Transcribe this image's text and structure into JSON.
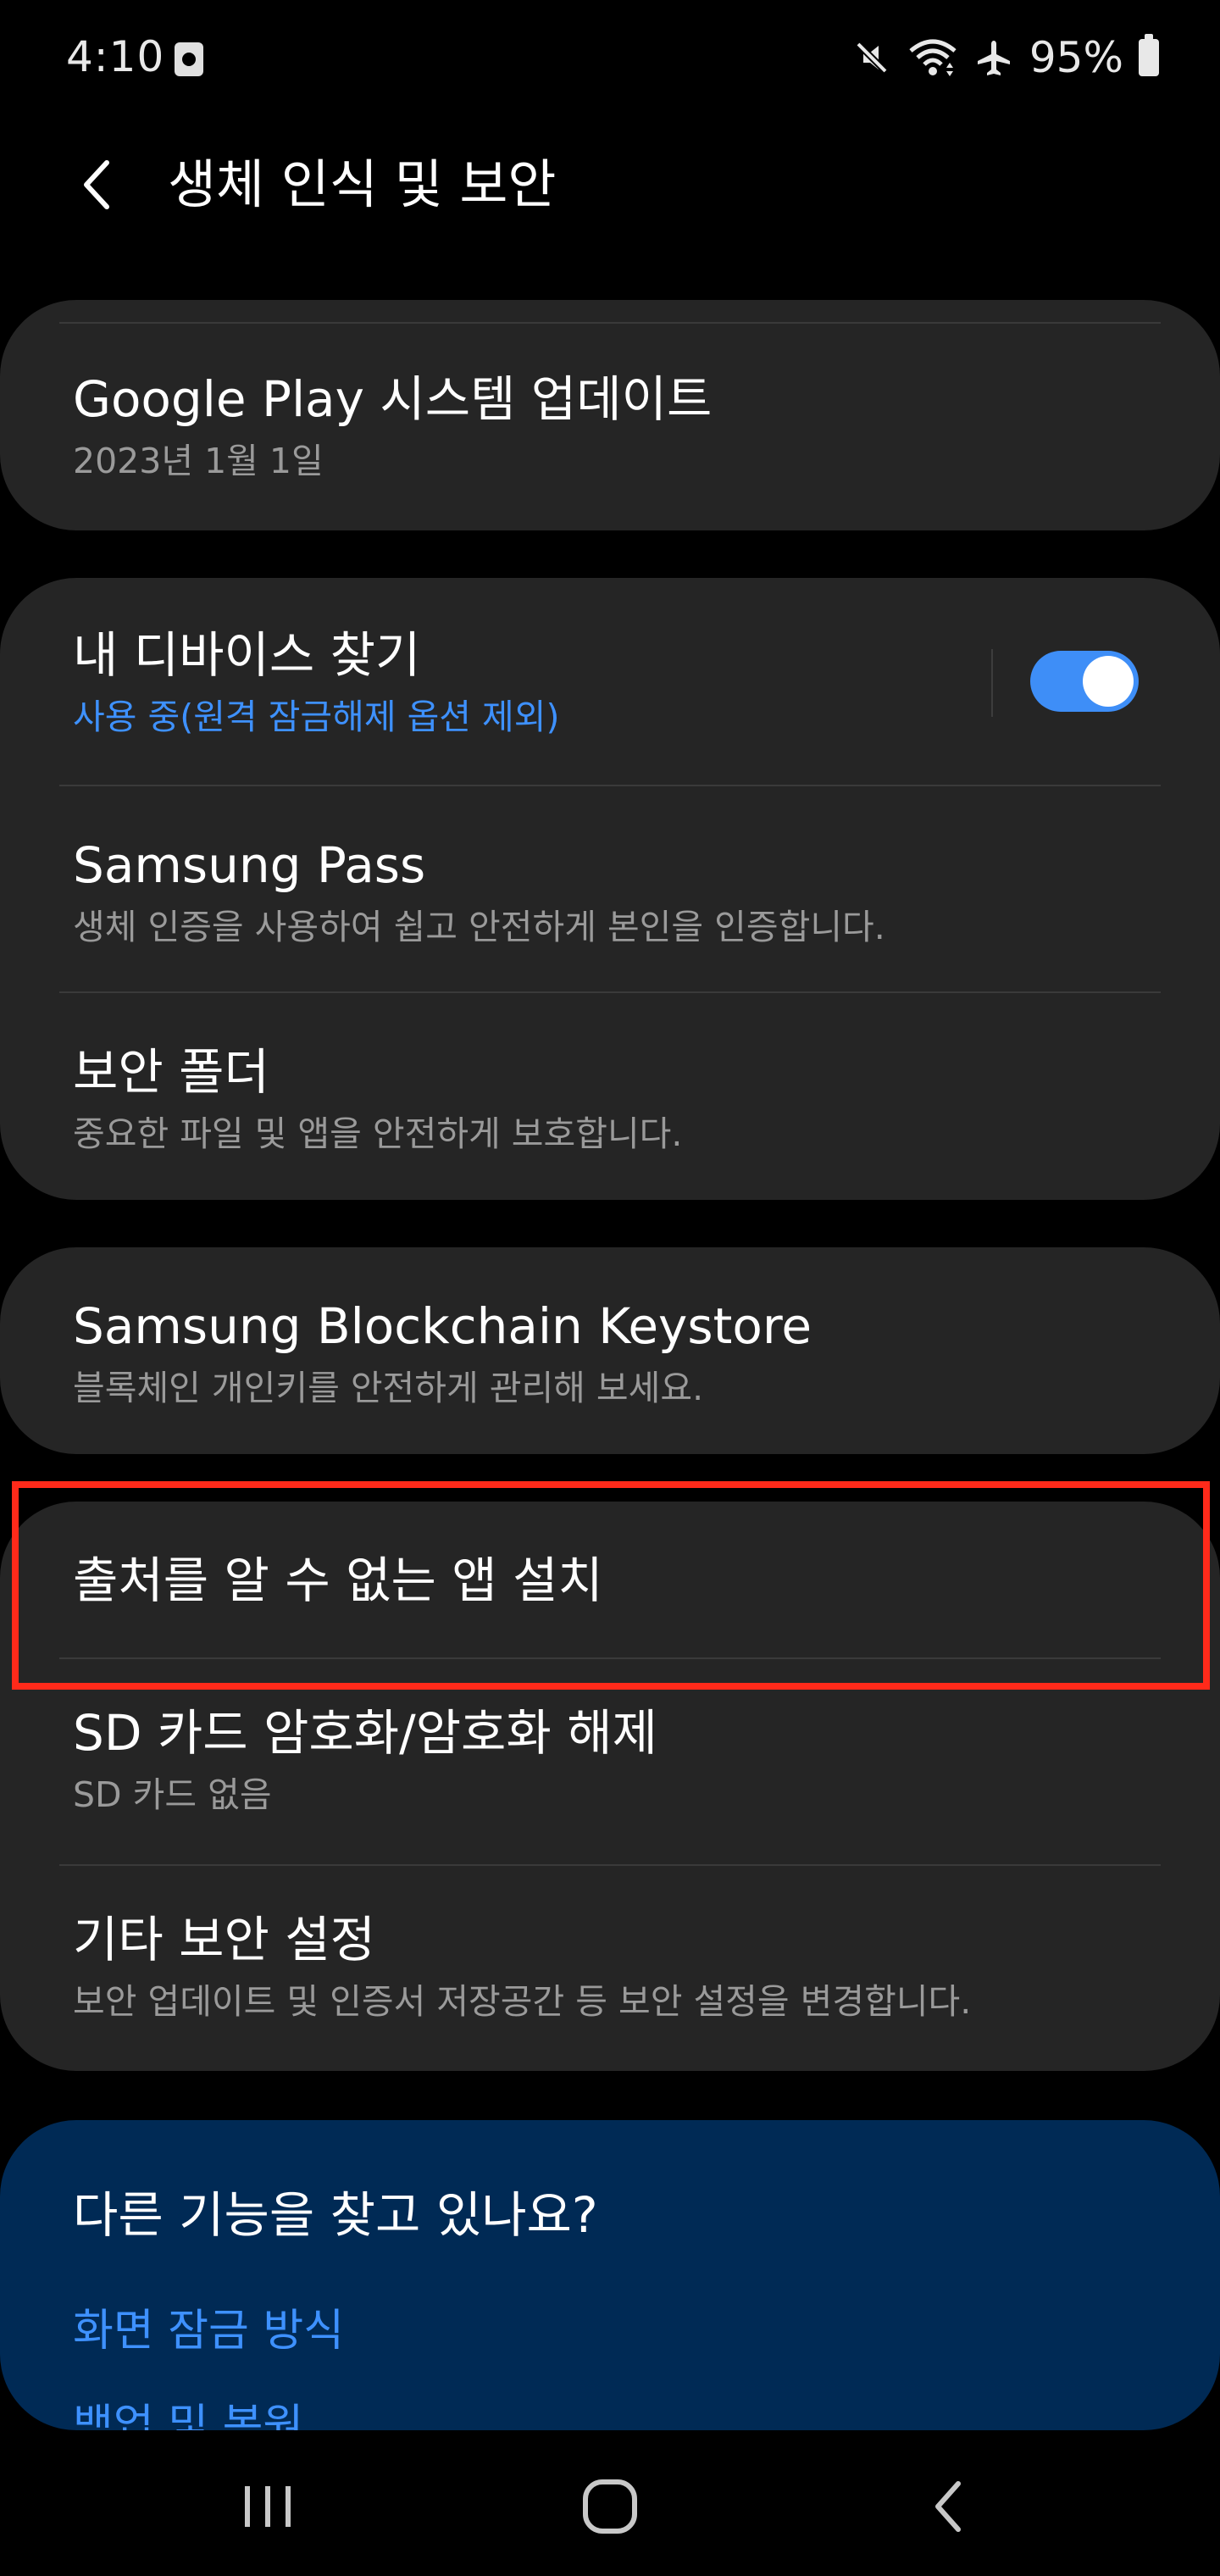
{
  "status_bar": {
    "time": "4:10",
    "battery": "95%",
    "icons": [
      "screen-record-icon",
      "mute-icon",
      "wifi-icon",
      "airplane-icon",
      "battery-icon"
    ]
  },
  "header": {
    "title": "생체 인식 및 보안",
    "back_icon": "back-arrow-icon"
  },
  "cards": {
    "google_play": {
      "title": "Google Play 시스템 업데이트",
      "subtitle": "2023년 1월 1일"
    },
    "find_device": {
      "title": "내 디바이스 찾기",
      "subtitle": "사용 중(원격 잠금해제 옵션 제외)",
      "toggle_on": true,
      "accent_color": "#3e8ef7"
    },
    "samsung_pass": {
      "title": "Samsung Pass",
      "subtitle": "생체 인증을 사용하여 쉽고 안전하게 본인을 인증합니다."
    },
    "secure_folder": {
      "title": "보안 폴더",
      "subtitle": "중요한 파일 및 앱을 안전하게 보호합니다."
    },
    "blockchain": {
      "title": "Samsung Blockchain Keystore",
      "subtitle": "블록체인 개인키를 안전하게 관리해 보세요."
    },
    "unknown_apps": {
      "title": "출처를 알 수 없는 앱 설치"
    },
    "sd_card": {
      "title": "SD 카드 암호화/암호화 해제",
      "subtitle": "SD 카드 없음"
    },
    "other_security": {
      "title": "기타 보안 설정",
      "subtitle": "보안 업데이트 및 인증서 저장공간 등 보안 설정을 변경합니다."
    }
  },
  "suggestions": {
    "title": "다른 기능을 찾고 있나요?",
    "links": [
      "화면 잠금 방식",
      "백업 및 복원"
    ],
    "background_color": "#002a55",
    "link_color": "#3e91ff"
  },
  "highlight_color": "#ff2a1a",
  "nav_bar": {
    "icons": [
      "recent-apps-icon",
      "home-icon",
      "back-icon"
    ]
  }
}
